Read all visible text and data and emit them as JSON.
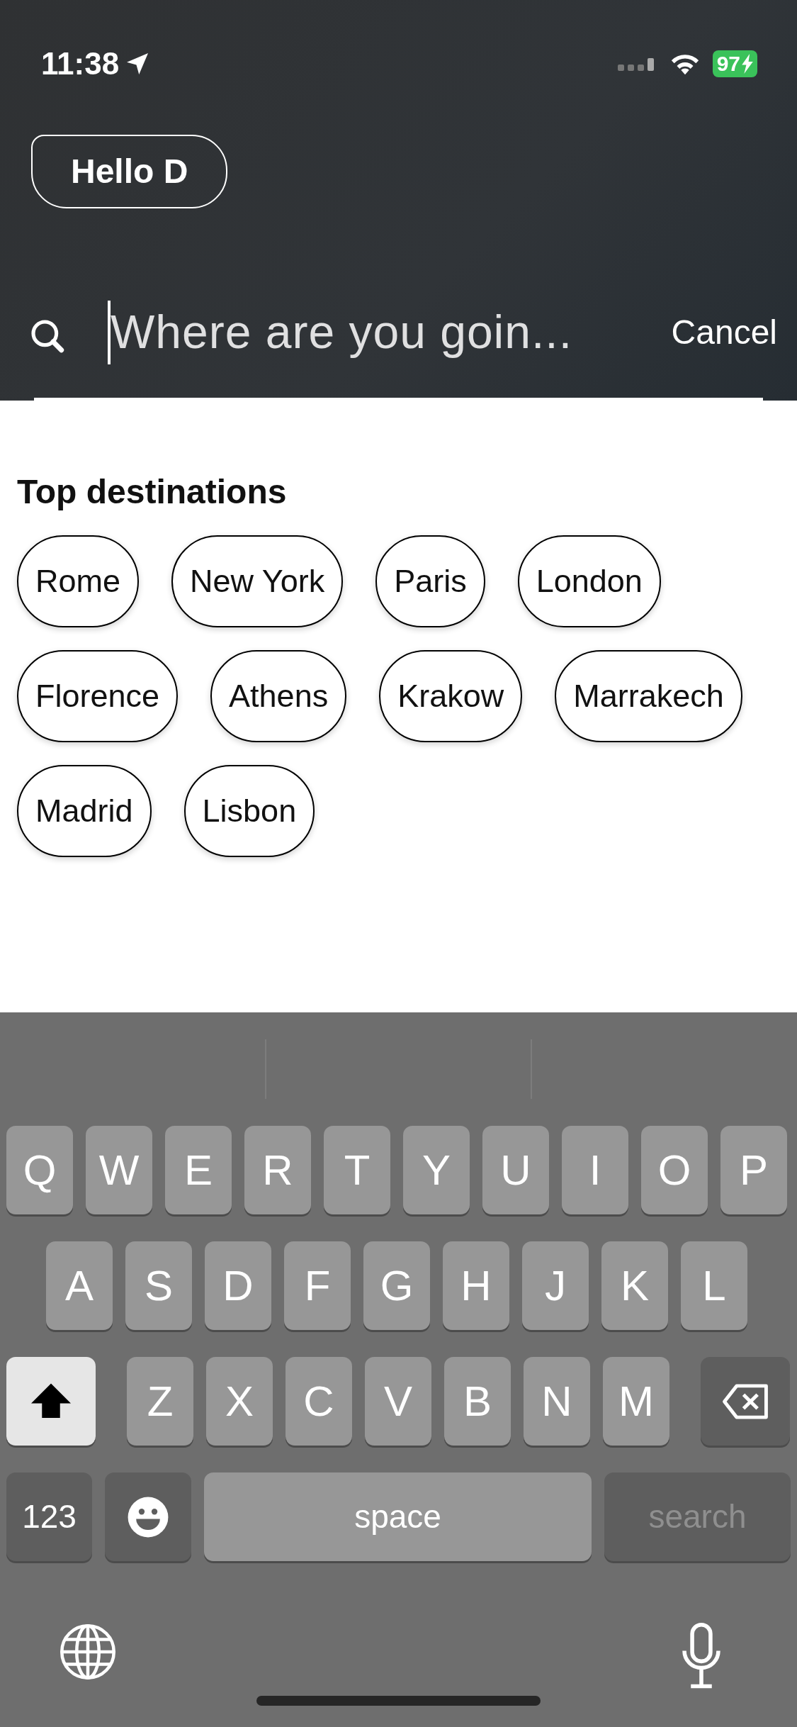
{
  "status_bar": {
    "time": "11:38",
    "battery": "97"
  },
  "greeting": {
    "label": "Hello D"
  },
  "search": {
    "placeholder": "Where are you goin...",
    "cancel": "Cancel"
  },
  "top_destinations": {
    "title": "Top destinations",
    "items": [
      "Rome",
      "New York",
      "Paris",
      "London",
      "Florence",
      "Athens",
      "Krakow",
      "Marrakech",
      "Madrid",
      "Lisbon"
    ]
  },
  "keyboard": {
    "letter_rows": [
      [
        {
          "kind": "letter",
          "label": "Q"
        },
        {
          "kind": "letter",
          "label": "W"
        },
        {
          "kind": "letter",
          "label": "E"
        },
        {
          "kind": "letter",
          "label": "R"
        },
        {
          "kind": "letter",
          "label": "T"
        },
        {
          "kind": "letter",
          "label": "Y"
        },
        {
          "kind": "letter",
          "label": "U"
        },
        {
          "kind": "letter",
          "label": "I"
        },
        {
          "kind": "letter",
          "label": "O"
        },
        {
          "kind": "letter",
          "label": "P"
        }
      ],
      [
        {
          "kind": "letter",
          "label": "A"
        },
        {
          "kind": "letter",
          "label": "S"
        },
        {
          "kind": "letter",
          "label": "D"
        },
        {
          "kind": "letter",
          "label": "F"
        },
        {
          "kind": "letter",
          "label": "G"
        },
        {
          "kind": "letter",
          "label": "H"
        },
        {
          "kind": "letter",
          "label": "J"
        },
        {
          "kind": "letter",
          "label": "K"
        },
        {
          "kind": "letter",
          "label": "L"
        }
      ],
      [
        {
          "kind": "shift",
          "on": true
        },
        {
          "kind": "letter",
          "label": "Z"
        },
        {
          "kind": "letter",
          "label": "X"
        },
        {
          "kind": "letter",
          "label": "C"
        },
        {
          "kind": "letter",
          "label": "V"
        },
        {
          "kind": "letter",
          "label": "B"
        },
        {
          "kind": "letter",
          "label": "N"
        },
        {
          "kind": "letter",
          "label": "M"
        },
        {
          "kind": "backspace"
        }
      ]
    ],
    "bottom_row": {
      "numbers": "123",
      "space": "space",
      "action": {
        "label": "search",
        "disabled": true
      }
    }
  }
}
